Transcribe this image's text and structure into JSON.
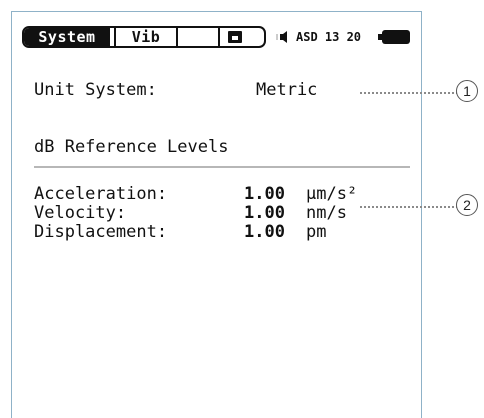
{
  "status_bar": {
    "tab_system": "System",
    "tab_vib": "Vib",
    "status_text": "ASD 13 20",
    "icons": [
      "save-icon",
      "speaker-icon",
      "battery-icon"
    ]
  },
  "settings": {
    "unit_system_label": "Unit System:",
    "unit_system_value": "Metric",
    "section_title": "dB Reference Levels",
    "rows": [
      {
        "label": "Acceleration:",
        "value": "1.00",
        "unit": "µm/s²"
      },
      {
        "label": "Velocity:",
        "value": "1.00",
        "unit": "nm/s"
      },
      {
        "label": "Displacement:",
        "value": "1.00",
        "unit": "pm"
      }
    ]
  },
  "callouts": [
    "1",
    "2"
  ]
}
